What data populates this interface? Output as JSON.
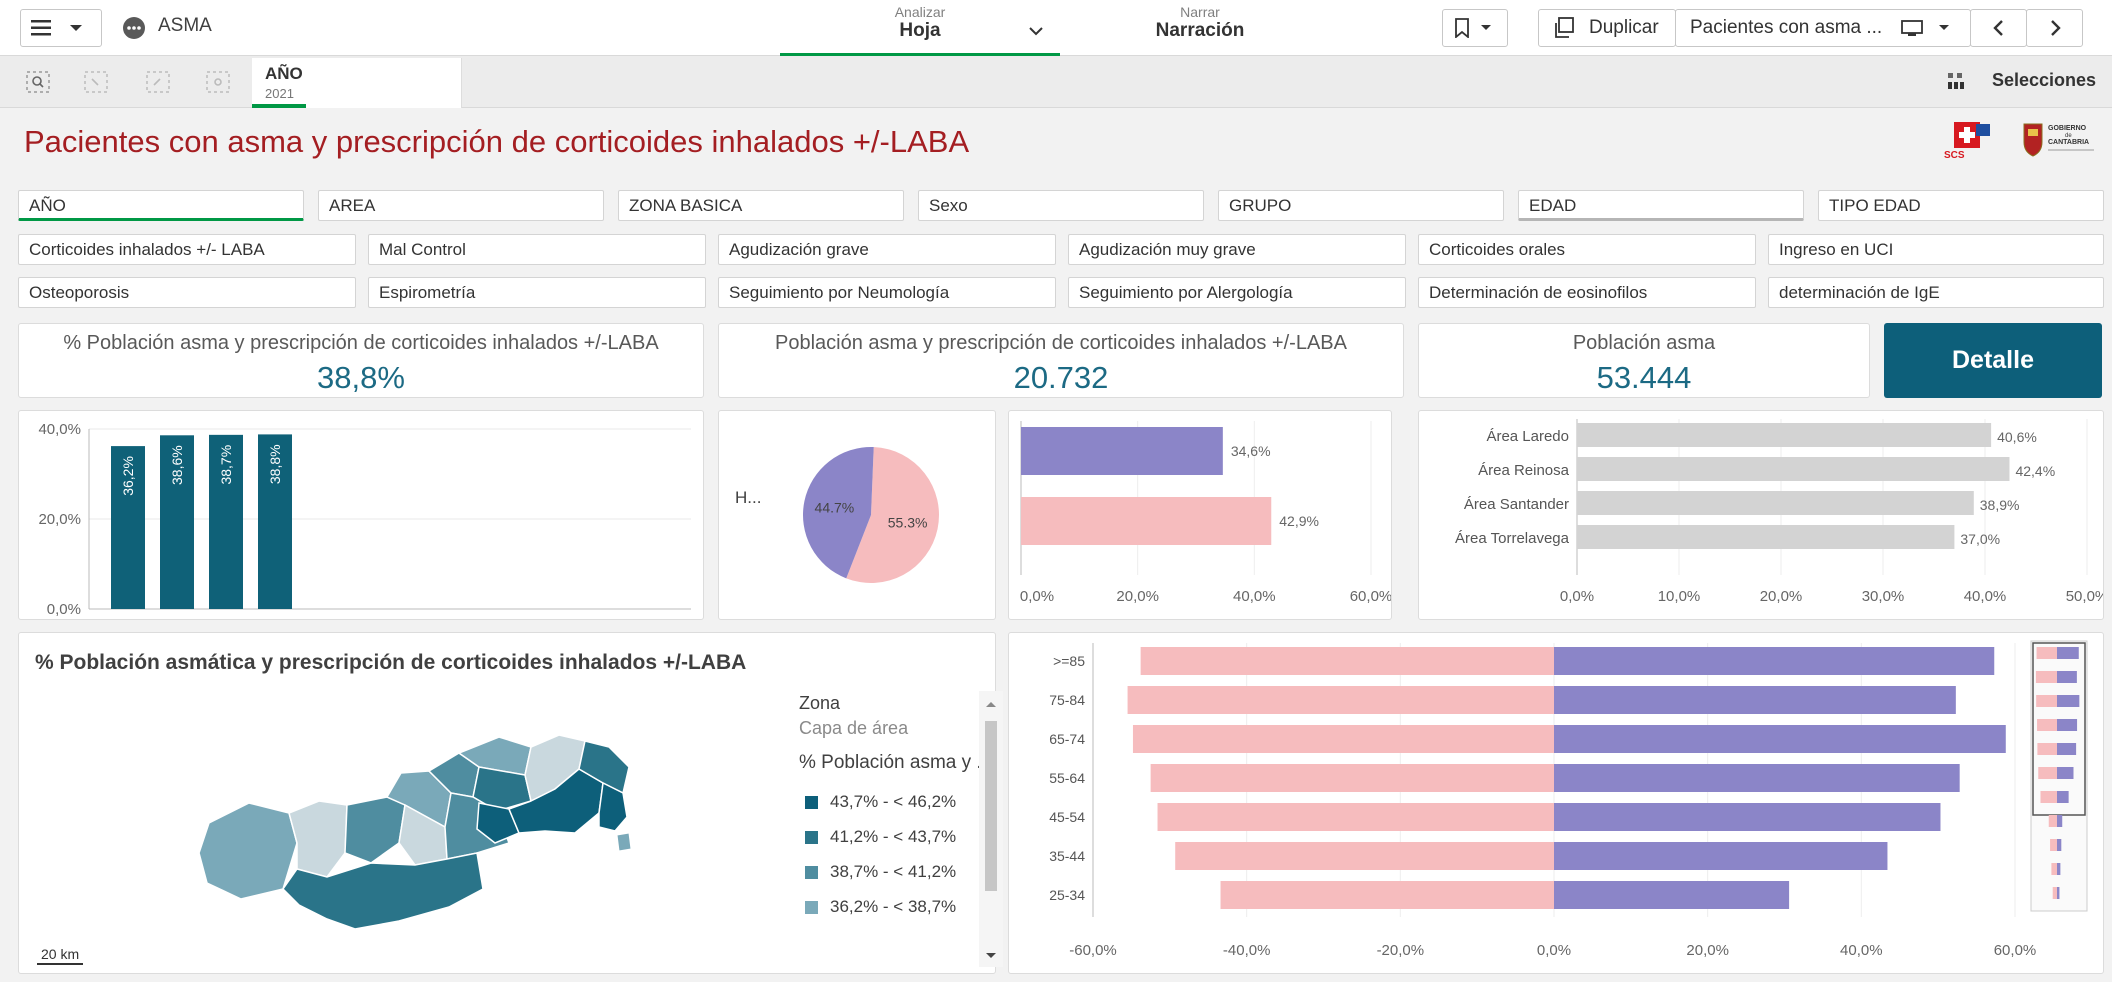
{
  "app": {
    "name": "ASMA"
  },
  "topbar": {
    "analyze_small": "Analizar",
    "analyze_big": "Hoja",
    "narrate_small": "Narrar",
    "narrate_big": "Narración",
    "duplicate_label": "Duplicar",
    "sheet_name": "Pacientes con asma ..."
  },
  "selections_bar": {
    "chip_label": "AÑO",
    "chip_value": "2021",
    "selections_label": "Selecciones"
  },
  "page_title": "Pacientes con asma y prescripción de corticoides inhalados +/-LABA",
  "logos": {
    "scs": "SCS",
    "gob1": "GOBIERNO",
    "gob2": "de",
    "gob3": "CANTABRIA"
  },
  "filters_row1": [
    "AÑO",
    "AREA",
    "ZONA BASICA",
    "Sexo",
    "GRUPO",
    "EDAD",
    "TIPO EDAD"
  ],
  "filters_row2": [
    "Corticoides inhalados +/- LABA",
    "Mal Control",
    "Agudización grave",
    "Agudización muy grave",
    "Corticoides orales",
    "Ingreso en UCI"
  ],
  "filters_row3": [
    "Osteoporosis",
    "Espirometría",
    "Seguimiento por Neumología",
    "Seguimiento por Alergología",
    "Determinación de eosinofilos",
    "determinación de IgE"
  ],
  "kpis": [
    {
      "label": "% Población asma y prescripción de corticoides inhalados +/-LABA",
      "value": "38,8%"
    },
    {
      "label": "Población asma y prescripción de corticoides inhalados +/-LABA",
      "value": "20.732"
    },
    {
      "label": "Población asma",
      "value": "53.444"
    }
  ],
  "detail_button": "Detalle",
  "colors": {
    "teal_dark": "#0d5f7a",
    "bar_teal": "#0f6178",
    "pink": "#f6bcbe",
    "purple": "#8b85c8",
    "grey_bar": "#d3d3d3",
    "title_red": "#a41e22"
  },
  "chart_data": [
    {
      "type": "bar",
      "y_ticks": [
        "40,0%",
        "20,0%",
        "0,0%"
      ],
      "values": [
        36.2,
        38.6,
        38.7,
        38.8
      ],
      "labels": [
        "36,2%",
        "38,6%",
        "38,7%",
        "38,8%"
      ],
      "ylim": [
        0,
        40
      ]
    },
    {
      "type": "pie",
      "legend_label": "H...",
      "slices": [
        {
          "value": 55.3,
          "label": "55.3%",
          "color": "#f6bcbe"
        },
        {
          "value": 44.7,
          "label": "44.7%",
          "color": "#8b85c8"
        }
      ]
    },
    {
      "type": "bar",
      "orientation": "horizontal",
      "values": [
        34.6,
        42.9
      ],
      "labels": [
        "34,6%",
        "42,9%"
      ],
      "colors": [
        "#8b85c8",
        "#f6bcbe"
      ],
      "x_ticks": [
        "0,0%",
        "20,0%",
        "40,0%",
        "60,0%"
      ],
      "xlim": [
        0,
        60
      ]
    },
    {
      "type": "bar",
      "orientation": "horizontal",
      "categories": [
        "Área Laredo",
        "Área Reinosa",
        "Área Santander",
        "Área Torrelavega"
      ],
      "values": [
        40.6,
        42.4,
        38.9,
        37.0
      ],
      "labels": [
        "40,6%",
        "42,4%",
        "38,9%",
        "37,0%"
      ],
      "x_ticks": [
        "0,0%",
        "10,0%",
        "20,0%",
        "30,0%",
        "40,0%",
        "50,0%"
      ],
      "xlim": [
        0,
        50
      ]
    },
    {
      "type": "bar",
      "orientation": "horizontal",
      "categories": [
        ">=85",
        "75-84",
        "65-74",
        "55-64",
        "45-54",
        "35-44",
        "25-34"
      ],
      "series": [
        {
          "values": [
            -53.8,
            -55.5,
            -54.8,
            -52.5,
            -51.6,
            -49.3,
            -43.4
          ],
          "color": "#f6bcbe"
        },
        {
          "values": [
            57.3,
            52.3,
            58.8,
            52.8,
            50.3,
            43.4,
            30.6
          ],
          "color": "#8b85c8"
        }
      ],
      "x_ticks": [
        "-60,0%",
        "-40,0%",
        "-20,0%",
        "0,0%",
        "20,0%",
        "40,0%",
        "60,0%"
      ],
      "xlim": [
        -60,
        60
      ]
    }
  ],
  "map": {
    "title": "% Población asmática y prescripción de corticoides inhalados +/-LABA",
    "legend_title": "Zona",
    "legend_sub": "Capa de área",
    "legend_measure": "% Población asma y ...",
    "legend_items": [
      {
        "label": "43,7% - < 46,2%",
        "color": "#0d5f7a"
      },
      {
        "label": "41,2% - < 43,7%",
        "color": "#2a7489"
      },
      {
        "label": "38,7% - < 41,2%",
        "color": "#4f8da0"
      },
      {
        "label": "36,2% - < 38,7%",
        "color": "#7aa9b9"
      }
    ],
    "scale_label": "20 km"
  }
}
